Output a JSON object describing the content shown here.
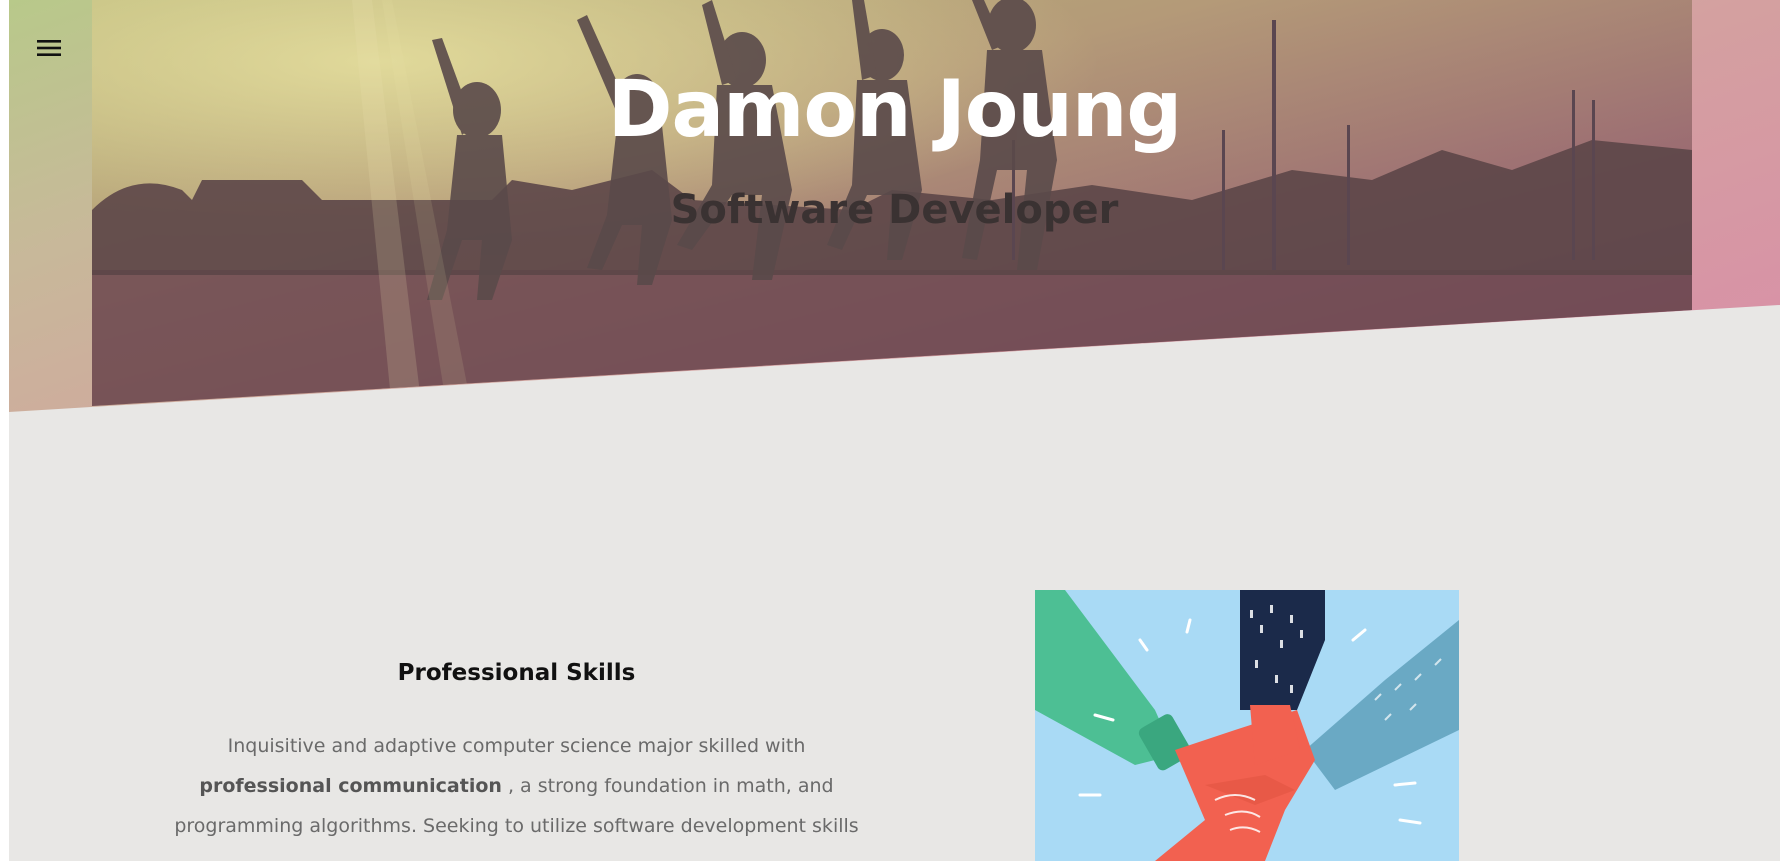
{
  "header": {
    "menu_icon": "hamburger-menu-icon",
    "title": "Damon Joung",
    "subtitle": "Software Developer"
  },
  "hero": {
    "gradient_colors": [
      "#b8c98a",
      "#d4a0a0",
      "#d98ea8"
    ],
    "photo_description_icon": "hero-photo"
  },
  "skills": {
    "heading": "Professional Skills",
    "text_part1": "Inquisitive and adaptive computer science major skilled with",
    "text_bold": "professional communication",
    "text_part2": " , a strong foundation in math, and",
    "text_part3": "programming algorithms. Seeking to utilize software development skills"
  },
  "illustration": {
    "icon": "teamwork-hands-illustration"
  },
  "colors": {
    "background": "#e8e7e5",
    "title_text": "#ffffff",
    "subtitle_text": "#3a3232",
    "body_text": "#6a6a6a"
  }
}
